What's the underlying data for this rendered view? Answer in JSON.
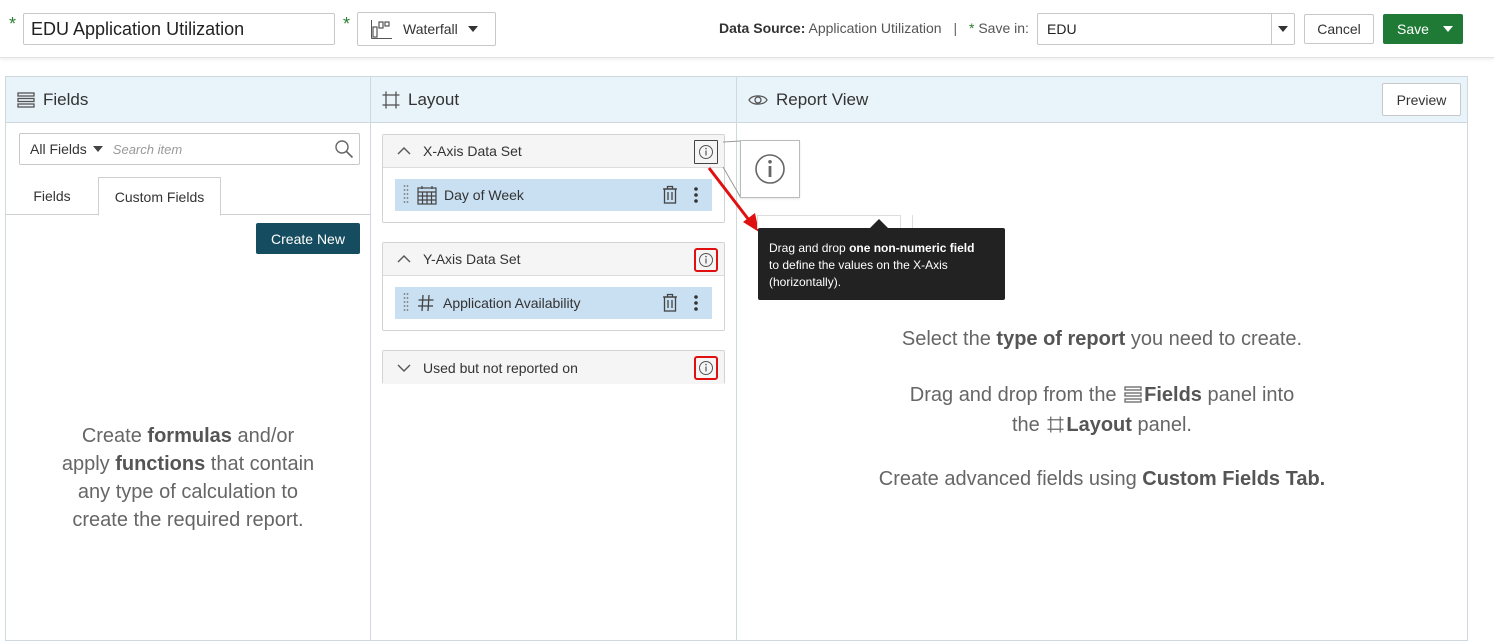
{
  "header": {
    "report_title": "EDU Application Utilization",
    "required_marker": "*",
    "chart_type": "Waterfall",
    "data_source_label": "Data Source:",
    "data_source_value": "Application Utilization",
    "separator": "|",
    "save_in_label": "Save in:",
    "save_in_value": "EDU",
    "cancel_label": "Cancel",
    "save_label": "Save",
    "accent_green": "#1f7a35"
  },
  "fields_panel": {
    "title": "Fields",
    "filter_value": "All Fields",
    "search_placeholder": "Search item",
    "tabs": [
      {
        "label": "Fields",
        "active": false
      },
      {
        "label": "Custom Fields",
        "active": true
      }
    ],
    "create_new_label": "Create New",
    "helper": {
      "l1_pre": "Create ",
      "l1_bold": "formulas",
      "l1_post": " and/or",
      "l2_pre": "apply ",
      "l2_bold": "functions",
      "l2_post": " that contain",
      "l3": "any type of calculation to",
      "l4": "create the required report."
    }
  },
  "layout_panel": {
    "title": "Layout",
    "datasets": [
      {
        "title": "X-Axis Data Set",
        "expanded": true,
        "items": [
          {
            "label": "Day of Week",
            "icon": "calendar-icon"
          }
        ]
      },
      {
        "title": "Y-Axis Data Set",
        "expanded": true,
        "items": [
          {
            "label": "Application Availability",
            "icon": "hash-icon"
          }
        ]
      },
      {
        "title": "Used but not reported on",
        "expanded": false,
        "items": []
      }
    ]
  },
  "report_view": {
    "title": "Report View",
    "preview_label": "Preview",
    "tooltip": {
      "pre": "Drag and drop ",
      "bold": "one non-numeric field",
      "line2": "to define the values on the X-Axis",
      "line3": "(horizontally)."
    },
    "msg1_pre": "Select the ",
    "msg1_bold": "type of report",
    "msg1_post": " you need to create.",
    "msg2_pre": "Drag and drop from the ",
    "msg2_bold": "Fields",
    "msg2_post": " panel into",
    "msg3_pre": "the ",
    "msg3_bold": "Layout",
    "msg3_post": " panel.",
    "msg4_pre": "Create advanced fields using ",
    "msg4_bold": "Custom Fields Tab."
  }
}
